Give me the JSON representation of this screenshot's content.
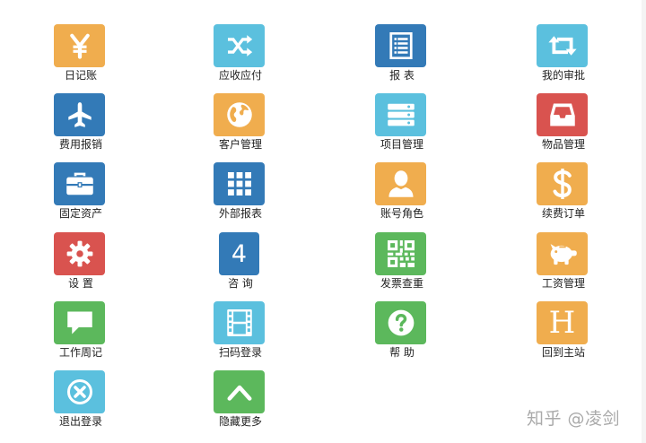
{
  "menu": {
    "items": [
      {
        "label": "日记账",
        "color": "#f0ad4e",
        "icon": "yen-icon"
      },
      {
        "label": "应收应付",
        "color": "#5bc0de",
        "icon": "shuffle-icon"
      },
      {
        "label": "报 表",
        "color": "#337ab7",
        "icon": "report-list-icon"
      },
      {
        "label": "我的审批",
        "color": "#5bc0de",
        "icon": "retweet-icon"
      },
      {
        "label": "费用报销",
        "color": "#337ab7",
        "icon": "plane-icon"
      },
      {
        "label": "客户管理",
        "color": "#f0ad4e",
        "icon": "globe-icon"
      },
      {
        "label": "项目管理",
        "color": "#5bc0de",
        "icon": "server-icon"
      },
      {
        "label": "物品管理",
        "color": "#d9534f",
        "icon": "inbox-tray-icon"
      },
      {
        "label": "固定资产",
        "color": "#337ab7",
        "icon": "briefcase-icon"
      },
      {
        "label": "外部报表",
        "color": "#337ab7",
        "icon": "grid-icon"
      },
      {
        "label": "账号角色",
        "color": "#f0ad4e",
        "icon": "user-icon"
      },
      {
        "label": "续费订单",
        "color": "#f0ad4e",
        "icon": "dollar-icon"
      },
      {
        "label": "设 置",
        "color": "#d9534f",
        "icon": "gear-icon"
      },
      {
        "label": "咨 询",
        "color": "#337ab7",
        "icon": "number-4-icon",
        "text": "4"
      },
      {
        "label": "发票查重",
        "color": "#5cb85c",
        "icon": "qrcode-icon"
      },
      {
        "label": "工资管理",
        "color": "#f0ad4e",
        "icon": "piggy-bank-icon"
      },
      {
        "label": "工作周记",
        "color": "#5cb85c",
        "icon": "comment-icon"
      },
      {
        "label": "扫码登录",
        "color": "#5bc0de",
        "icon": "film-icon"
      },
      {
        "label": "帮 助",
        "color": "#5cb85c",
        "icon": "question-icon"
      },
      {
        "label": "回到主站",
        "color": "#f0ad4e",
        "icon": "letter-h-icon",
        "text": "H"
      },
      {
        "label": "退出登录",
        "color": "#5bc0de",
        "icon": "close-circle-icon"
      },
      {
        "label": "隐藏更多",
        "color": "#5cb85c",
        "icon": "chevron-up-icon"
      }
    ]
  },
  "watermark": "知乎 @凌剑"
}
